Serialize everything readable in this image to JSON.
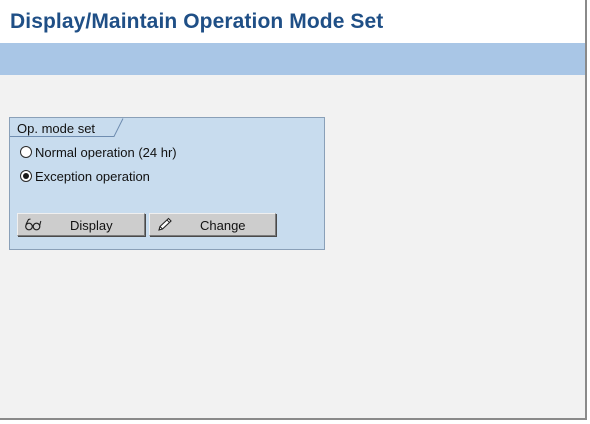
{
  "header": {
    "title": "Display/Maintain Operation Mode Set"
  },
  "op_mode_set": {
    "label": "Op. mode set",
    "options": [
      {
        "label": "Normal operation (24 hr)",
        "selected": false
      },
      {
        "label": "Exception operation",
        "selected": true
      }
    ]
  },
  "buttons": {
    "display": {
      "label": "Display",
      "icon": "glasses-icon"
    },
    "change": {
      "label": "Change",
      "icon": "pencil-icon"
    }
  },
  "colors": {
    "title_text": "#1f4f86",
    "toolbar": "#a9c6e6",
    "group_background": "#c8dcee",
    "background": "#f2f2f2"
  }
}
